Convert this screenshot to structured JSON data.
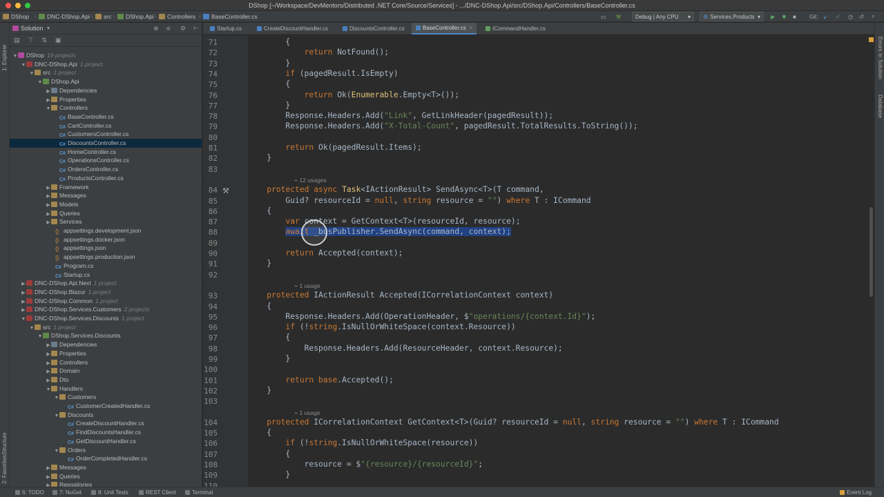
{
  "window": {
    "title": "DShop [~/Workspace/DevMentors/Distributed .NET Core/Source/Services] - .../DNC-DShop.Api/src/DShop.Api/Controllers/BaseController.cs"
  },
  "breadcrumbs": [
    "DShop",
    "DNC-DShop.Api",
    "src",
    "DShop.Api",
    "Controllers",
    "BaseController.cs"
  ],
  "toolbar": {
    "config": "Debug | Any CPU",
    "run_config": "Services.Products",
    "git_label": "Git:"
  },
  "explorer": {
    "title": "Solution",
    "tree": [
      {
        "label": "DShop",
        "sub": "19 projects",
        "indent": 0,
        "arrow": "▼",
        "icon": "sln"
      },
      {
        "label": "DNC-DShop.Api",
        "sub": "1 project",
        "indent": 1,
        "arrow": "▼",
        "icon": "proj"
      },
      {
        "label": "src",
        "sub": "1 project",
        "indent": 2,
        "arrow": "▼",
        "icon": "folder"
      },
      {
        "label": "DShop.Api",
        "sub": "",
        "indent": 3,
        "arrow": "▼",
        "icon": "proj2"
      },
      {
        "label": "Dependencies",
        "sub": "",
        "indent": 4,
        "arrow": "▶",
        "icon": "dep"
      },
      {
        "label": "Properties",
        "sub": "",
        "indent": 4,
        "arrow": "▶",
        "icon": "folder"
      },
      {
        "label": "Controllers",
        "sub": "",
        "indent": 4,
        "arrow": "▼",
        "icon": "folder"
      },
      {
        "label": "BaseController.cs",
        "sub": "",
        "indent": 5,
        "arrow": "",
        "icon": "cs"
      },
      {
        "label": "CartController.cs",
        "sub": "",
        "indent": 5,
        "arrow": "",
        "icon": "cs"
      },
      {
        "label": "CustomersController.cs",
        "sub": "",
        "indent": 5,
        "arrow": "",
        "icon": "cs"
      },
      {
        "label": "DiscountsController.cs",
        "sub": "",
        "indent": 5,
        "arrow": "",
        "icon": "cs",
        "selected": true
      },
      {
        "label": "HomeController.cs",
        "sub": "",
        "indent": 5,
        "arrow": "",
        "icon": "cs"
      },
      {
        "label": "OperationsController.cs",
        "sub": "",
        "indent": 5,
        "arrow": "",
        "icon": "cs"
      },
      {
        "label": "OrdersController.cs",
        "sub": "",
        "indent": 5,
        "arrow": "",
        "icon": "cs"
      },
      {
        "label": "ProductsController.cs",
        "sub": "",
        "indent": 5,
        "arrow": "",
        "icon": "cs"
      },
      {
        "label": "Framework",
        "sub": "",
        "indent": 4,
        "arrow": "▶",
        "icon": "folder"
      },
      {
        "label": "Messages",
        "sub": "",
        "indent": 4,
        "arrow": "▶",
        "icon": "folder"
      },
      {
        "label": "Models",
        "sub": "",
        "indent": 4,
        "arrow": "▶",
        "icon": "folder"
      },
      {
        "label": "Queries",
        "sub": "",
        "indent": 4,
        "arrow": "▶",
        "icon": "folder"
      },
      {
        "label": "Services",
        "sub": "",
        "indent": 4,
        "arrow": "▶",
        "icon": "folder"
      },
      {
        "label": "appsettings.development.json",
        "sub": "",
        "indent": 4.5,
        "arrow": "",
        "icon": "json"
      },
      {
        "label": "appsettings.docker.json",
        "sub": "",
        "indent": 4.5,
        "arrow": "",
        "icon": "json"
      },
      {
        "label": "appsettings.json",
        "sub": "",
        "indent": 4.5,
        "arrow": "",
        "icon": "json"
      },
      {
        "label": "appsettings.production.json",
        "sub": "",
        "indent": 4.5,
        "arrow": "",
        "icon": "json"
      },
      {
        "label": "Program.cs",
        "sub": "",
        "indent": 4.5,
        "arrow": "",
        "icon": "cs"
      },
      {
        "label": "Startup.cs",
        "sub": "",
        "indent": 4.5,
        "arrow": "",
        "icon": "cs"
      },
      {
        "label": "DNC-DShop.Api.Next",
        "sub": "1 project",
        "indent": 1,
        "arrow": "▶",
        "icon": "proj"
      },
      {
        "label": "DNC-DShop.Blazor",
        "sub": "1 project",
        "indent": 1,
        "arrow": "▶",
        "icon": "proj"
      },
      {
        "label": "DNC-DShop.Common",
        "sub": "1 project",
        "indent": 1,
        "arrow": "▶",
        "icon": "proj"
      },
      {
        "label": "DNC-DShop.Services.Customers",
        "sub": "2 projects",
        "indent": 1,
        "arrow": "▶",
        "icon": "proj"
      },
      {
        "label": "DNC-DShop.Services.Discounts",
        "sub": "1 project",
        "indent": 1,
        "arrow": "▼",
        "icon": "proj"
      },
      {
        "label": "src",
        "sub": "1 project",
        "indent": 2,
        "arrow": "▼",
        "icon": "folder"
      },
      {
        "label": "DShop.Services.Discounts",
        "sub": "",
        "indent": 3,
        "arrow": "▼",
        "icon": "proj2"
      },
      {
        "label": "Dependencies",
        "sub": "",
        "indent": 4,
        "arrow": "▶",
        "icon": "dep"
      },
      {
        "label": "Properties",
        "sub": "",
        "indent": 4,
        "arrow": "▶",
        "icon": "folder"
      },
      {
        "label": "Controllers",
        "sub": "",
        "indent": 4,
        "arrow": "▶",
        "icon": "folder"
      },
      {
        "label": "Domain",
        "sub": "",
        "indent": 4,
        "arrow": "▶",
        "icon": "folder"
      },
      {
        "label": "Dto",
        "sub": "",
        "indent": 4,
        "arrow": "▶",
        "icon": "folder"
      },
      {
        "label": "Handlers",
        "sub": "",
        "indent": 4,
        "arrow": "▼",
        "icon": "folder"
      },
      {
        "label": "Customers",
        "sub": "",
        "indent": 5,
        "arrow": "▼",
        "icon": "folder"
      },
      {
        "label": "CustomerCreatedHandler.cs",
        "sub": "",
        "indent": 6,
        "arrow": "",
        "icon": "cs"
      },
      {
        "label": "Discounts",
        "sub": "",
        "indent": 5,
        "arrow": "▼",
        "icon": "folder"
      },
      {
        "label": "CreateDiscountHandler.cs",
        "sub": "",
        "indent": 6,
        "arrow": "",
        "icon": "cs"
      },
      {
        "label": "FindDiscountsHandler.cs",
        "sub": "",
        "indent": 6,
        "arrow": "",
        "icon": "cs"
      },
      {
        "label": "GetDiscountHandler.cs",
        "sub": "",
        "indent": 6,
        "arrow": "",
        "icon": "cs"
      },
      {
        "label": "Orders",
        "sub": "",
        "indent": 5,
        "arrow": "▼",
        "icon": "folder"
      },
      {
        "label": "OrderCompletedHandler.cs",
        "sub": "",
        "indent": 6,
        "arrow": "",
        "icon": "cs"
      },
      {
        "label": "Messages",
        "sub": "",
        "indent": 4,
        "arrow": "▶",
        "icon": "folder"
      },
      {
        "label": "Queries",
        "sub": "",
        "indent": 4,
        "arrow": "▶",
        "icon": "folder"
      },
      {
        "label": "Repositories",
        "sub": "",
        "indent": 4,
        "arrow": "▶",
        "icon": "folder"
      }
    ]
  },
  "tabs": [
    {
      "label": "Startup.cs",
      "active": false
    },
    {
      "label": "CreateDiscountHandler.cs",
      "active": false
    },
    {
      "label": "DiscountsController.cs",
      "active": false
    },
    {
      "label": "BaseController.cs",
      "active": true
    },
    {
      "label": "ICommandHandler.cs",
      "active": false
    }
  ],
  "editor": {
    "lines": [
      {
        "n": "71",
        "text": "        {"
      },
      {
        "n": "72",
        "text": "            return NotFound();"
      },
      {
        "n": "73",
        "text": "        }"
      },
      {
        "n": "74",
        "text": "        if (pagedResult.IsEmpty)"
      },
      {
        "n": "75",
        "text": "        {"
      },
      {
        "n": "76",
        "text": "            return Ok(Enumerable.Empty<T>());"
      },
      {
        "n": "77",
        "text": "        }"
      },
      {
        "n": "78",
        "text": "        Response.Headers.Add(\"Link\", GetLinkHeader(pagedResult));"
      },
      {
        "n": "79",
        "text": "        Response.Headers.Add(\"X-Total-Count\", pagedResult.TotalResults.ToString());"
      },
      {
        "n": "80",
        "text": ""
      },
      {
        "n": "81",
        "text": "        return Ok(pagedResult.Items);"
      },
      {
        "n": "82",
        "text": "    }"
      },
      {
        "n": "83",
        "text": ""
      },
      {
        "usage": "12 usages"
      },
      {
        "n": "84",
        "text": "    protected async Task<IActionResult> SendAsync<T>(T command,"
      },
      {
        "n": "85",
        "text": "        Guid? resourceId = null, string resource = \"\") where T : ICommand"
      },
      {
        "n": "86",
        "text": "    {"
      },
      {
        "n": "87",
        "text": "        var context = GetContext<T>(resourceId, resource);"
      },
      {
        "n": "88",
        "text": "        await _busPublisher.SendAsync(command, context);",
        "highlight": true
      },
      {
        "n": "89",
        "text": ""
      },
      {
        "n": "90",
        "text": "        return Accepted(context);"
      },
      {
        "n": "91",
        "text": "    }"
      },
      {
        "n": "92",
        "text": ""
      },
      {
        "usage": "1 usage"
      },
      {
        "n": "93",
        "text": "    protected IActionResult Accepted(ICorrelationContext context)"
      },
      {
        "n": "94",
        "text": "    {"
      },
      {
        "n": "95",
        "text": "        Response.Headers.Add(OperationHeader, $\"operations/{context.Id}\");"
      },
      {
        "n": "96",
        "text": "        if (!string.IsNullOrWhiteSpace(context.Resource))"
      },
      {
        "n": "97",
        "text": "        {"
      },
      {
        "n": "98",
        "text": "            Response.Headers.Add(ResourceHeader, context.Resource);"
      },
      {
        "n": "99",
        "text": "        }"
      },
      {
        "n": "100",
        "text": ""
      },
      {
        "n": "101",
        "text": "        return base.Accepted();"
      },
      {
        "n": "102",
        "text": "    }"
      },
      {
        "n": "103",
        "text": ""
      },
      {
        "usage": "1 usage"
      },
      {
        "n": "104",
        "text": "    protected ICorrelationContext GetContext<T>(Guid? resourceId = null, string resource = \"\") where T : ICommand"
      },
      {
        "n": "105",
        "text": "    {"
      },
      {
        "n": "106",
        "text": "        if (!string.IsNullOrWhiteSpace(resource))"
      },
      {
        "n": "107",
        "text": "        {"
      },
      {
        "n": "108",
        "text": "            resource = $\"{resource}/{resourceId}\";"
      },
      {
        "n": "109",
        "text": "        }"
      },
      {
        "n": "110",
        "text": ""
      }
    ]
  },
  "left_strip": [
    "1: Explorer",
    "Structure",
    "2: Favorites"
  ],
  "right_strip": [
    "Errors In Solution",
    "Database"
  ],
  "status": {
    "items": [
      "6: TODO",
      "7: NuGet",
      "8: Unit Tests",
      "REST Client",
      "Terminal"
    ],
    "event_log": "Event Log"
  },
  "colors": {
    "editor_bg": "#2b2b2b",
    "panel_bg": "#3c3f41",
    "selection": "#214283",
    "keyword": "#cc7832",
    "string": "#6a8759"
  }
}
